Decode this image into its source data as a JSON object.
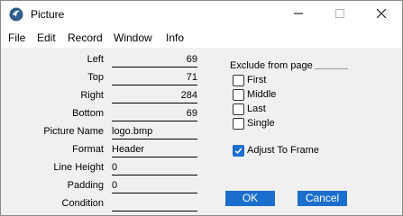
{
  "window": {
    "title": "Picture"
  },
  "menu": [
    "File",
    "Edit",
    "Record",
    "Window",
    "Info"
  ],
  "fields": [
    {
      "label": "Left",
      "value": "69"
    },
    {
      "label": "Top",
      "value": "71"
    },
    {
      "label": "Right",
      "value": "284"
    },
    {
      "label": "Bottom",
      "value": "69"
    },
    {
      "label": "Picture Name",
      "value": "logo.bmp"
    },
    {
      "label": "Format",
      "value": "Header"
    },
    {
      "label": "Line Height",
      "value": "0"
    },
    {
      "label": "Padding",
      "value": "0"
    },
    {
      "label": "Condition",
      "value": ""
    }
  ],
  "exclude": {
    "label": "Exclude from page",
    "options": [
      {
        "label": "First",
        "checked": false
      },
      {
        "label": "Middle",
        "checked": false
      },
      {
        "label": "Last",
        "checked": false
      },
      {
        "label": "Single",
        "checked": false
      }
    ]
  },
  "adjust_to_frame": {
    "label": "Adjust To Frame",
    "checked": true
  },
  "buttons": {
    "ok": "OK",
    "cancel": "Cancel"
  },
  "colors": {
    "accent": "#1a6fcc"
  },
  "icons": {
    "app": "app-logo-icon",
    "minimize": "minimize-icon",
    "maximize": "maximize-icon",
    "close": "close-icon"
  }
}
